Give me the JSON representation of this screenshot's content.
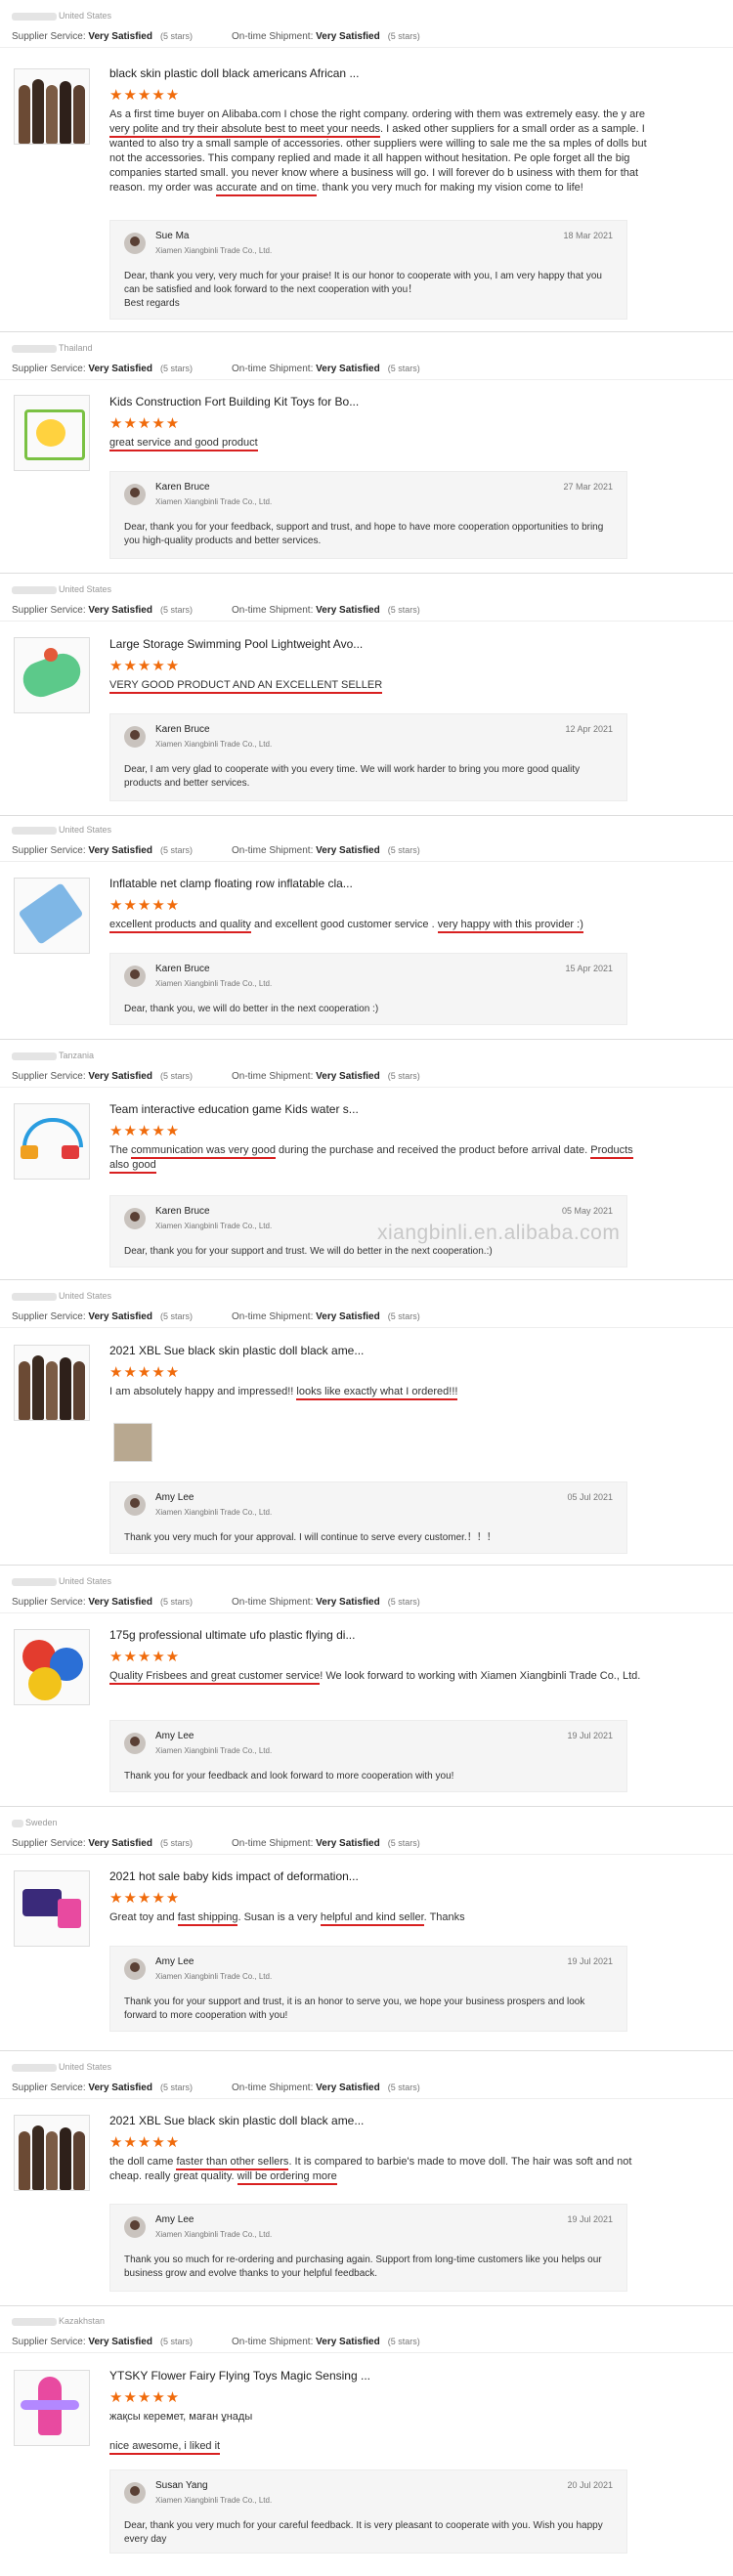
{
  "labels": {
    "supplier_service": "Supplier Service:",
    "ontime_shipment": "On-time Shipment:",
    "very_satisfied": "Very Satisfied",
    "five_stars": "(5 stars)",
    "stars": "★★★★★",
    "company": "Xiamen Xiangbinli Trade Co., Ltd."
  },
  "watermark": "xiangbinli.en.alibaba.com",
  "reviews": [
    {
      "country": "United States",
      "title": "black skin plastic doll black americans African ...",
      "text": {
        "a": "As a first time buyer on Alibaba.com I chose the right company. ordering with them was extremely easy. the y are ",
        "u1": "very polite and try their absolute best to meet your needs",
        "b": ". I asked other suppliers for a small order as a sample. I wanted to also try a small sample of accessories. other suppliers were willing to sale me the sa mples of dolls but not the accessories. This company replied and made it all happen without hesitation. Pe ople forget all the big companies started small. you never know where a business will go. I will forever do b usiness with them for that reason. my order was ",
        "u2": "accurate and on time",
        "c": ". thank you very much for making my vision come to life!"
      },
      "reply": {
        "name": "Sue Ma",
        "date": "18 Mar 2021",
        "text": "Dear, thank you very, very much for your praise! It is our honor to cooperate with you, I am very happy that you can be satisfied and look forward to the next cooperation with you！\nBest regards"
      }
    },
    {
      "country": "Thailand",
      "title": "Kids Construction Fort Building Kit Toys for Bo...",
      "text": {
        "u1": "great service and good product"
      },
      "reply": {
        "name": "Karen Bruce",
        "date": "27 Mar 2021",
        "text": "Dear, thank you for your feedback, support and trust, and hope to have more cooperation opportunities to bring you high-quality products and better services."
      }
    },
    {
      "country": "United States",
      "title": "Large Storage Swimming Pool Lightweight Avo...",
      "text": {
        "u1": "VERY GOOD PRODUCT AND AN EXCELLENT SELLER"
      },
      "reply": {
        "name": "Karen Bruce",
        "date": "12 Apr 2021",
        "text": "Dear, I am very glad to cooperate with you every time. We will work harder to bring you more good quality products and better services."
      }
    },
    {
      "country": "United States",
      "title": "Inflatable net clamp floating row inflatable cla...",
      "text": {
        "u1": "excellent products and quality",
        "a": " and excellent good customer service . ",
        "u2": "very happy with this provider :)"
      },
      "reply": {
        "name": "Karen Bruce",
        "date": "15 Apr 2021",
        "text": "Dear, thank you, we will do better in the next cooperation :)"
      }
    },
    {
      "country": "Tanzania",
      "title": "Team interactive education game Kids water s...",
      "text": {
        "a": "The ",
        "u1": "communication was very good",
        "b": " during the purchase and received the product before arrival date. ",
        "u2": "Products also good"
      },
      "reply": {
        "name": "Karen Bruce",
        "date": "05 May 2021",
        "text": "Dear, thank you for your support and trust. We will do better in the next cooperation.:)"
      }
    },
    {
      "country": "United States",
      "title": "2021 XBL Sue black skin plastic doll black ame...",
      "text": {
        "a": "I am absolutely happy and impressed!! ",
        "u1": "looks like exactly what I ordered!!!"
      },
      "reply": {
        "name": "Amy Lee",
        "date": "05 Jul 2021",
        "text": "Thank you very much for your approval. I will continue to serve every customer.！！！"
      }
    },
    {
      "country": "United States",
      "title": "175g professional ultimate ufo plastic flying di...",
      "text": {
        "u1": "Quality Frisbees and great customer service",
        "a": "! We look forward to working with Xiamen Xiangbinli Trade Co., Ltd."
      },
      "reply": {
        "name": "Amy Lee",
        "date": "19 Jul 2021",
        "text": "Thank you for your feedback and look forward to more cooperation with you!"
      }
    },
    {
      "country": "Sweden",
      "title": "2021 hot sale baby kids impact of deformation...",
      "text": {
        "a": "Great toy and ",
        "u1": "fast shipping",
        "b": ". Susan is a very ",
        "u2": "helpful and kind seller",
        "c": ". Thanks"
      },
      "reply": {
        "name": "Amy Lee",
        "date": "19 Jul 2021",
        "text": "Thank you for your support and trust, it is an honor to serve you, we hope your business prospers and look forward to more cooperation with you!"
      }
    },
    {
      "country": "United States",
      "title": "2021 XBL Sue black skin plastic doll black ame...",
      "text": {
        "a": "the doll came ",
        "u1": "faster than other sellers",
        "b": ".  It is compared to barbie's made to move doll. The hair was soft and not cheap. really great quality.  ",
        "u2": "will be ordering more"
      },
      "reply": {
        "name": "Amy Lee",
        "date": "19 Jul 2021",
        "text": "Thank you so much for re-ordering and purchasing again. Support from long-time customers like you helps our business grow and evolve thanks to your helpful feedback."
      }
    },
    {
      "country": "Kazakhstan",
      "title": "YTSKY Flower Fairy Flying Toys Magic Sensing ...",
      "text": {
        "a": "жақсы керемет, маған ұнады",
        "u1": "nice awesome, i liked it"
      },
      "reply": {
        "name": "Susan Yang",
        "date": "20 Jul 2021",
        "text": "Dear, thank you very much for your careful feedback. It is very pleasant to cooperate with you. Wish you happy every day"
      }
    }
  ]
}
